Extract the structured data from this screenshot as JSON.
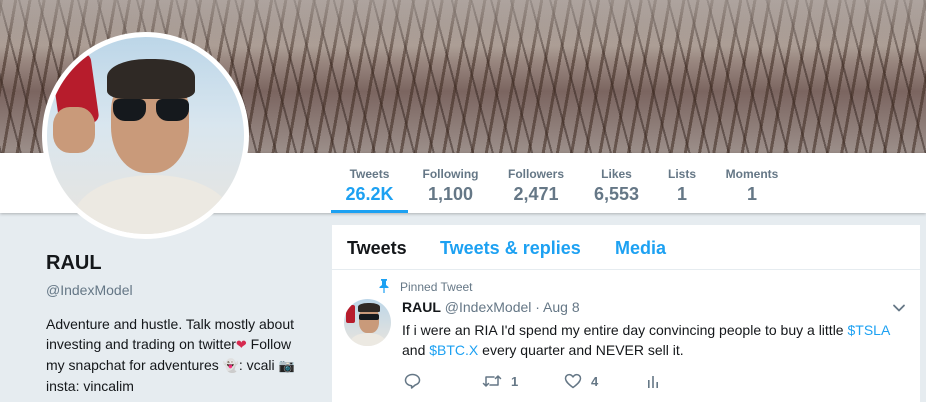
{
  "nav": {
    "stats": [
      {
        "label": "Tweets",
        "value": "26.2K",
        "active": true
      },
      {
        "label": "Following",
        "value": "1,100"
      },
      {
        "label": "Followers",
        "value": "2,471"
      },
      {
        "label": "Likes",
        "value": "6,553"
      },
      {
        "label": "Lists",
        "value": "1"
      },
      {
        "label": "Moments",
        "value": "1"
      }
    ]
  },
  "profile": {
    "name": "RAUL",
    "handle": "@IndexModel",
    "bio": {
      "part1": "Adventure and hustle. Talk mostly about investing and trading on twitter",
      "part2": " Follow my snapchat for adventures ",
      "part3": ": vcali",
      "part4": "insta: vincalim"
    }
  },
  "timeline": {
    "tabs": [
      {
        "label": "Tweets",
        "active": true
      },
      {
        "label": "Tweets & replies"
      },
      {
        "label": "Media"
      }
    ],
    "pinned_label": "Pinned Tweet",
    "tweet": {
      "name": "RAUL",
      "handle": "@IndexModel",
      "separator": " · ",
      "date": "Aug 8",
      "text_part1": "If i were an RIA I'd spend my entire day convincing people to buy a little ",
      "cashtag1": "$TSLA",
      "text_part2": "and ",
      "cashtag2": "$BTC.X",
      "text_part3": " every quarter and NEVER sell it.",
      "retweets": "1",
      "likes": "4"
    }
  },
  "colors": {
    "accent": "#1da1f2",
    "muted": "#657786",
    "background": "#e6ecf0"
  },
  "icons": [
    "pin-icon",
    "reply-icon",
    "retweet-icon",
    "like-icon",
    "analytics-icon",
    "chevron-down-icon",
    "red-heart-emoji",
    "ghost-emoji",
    "camera-emoji"
  ]
}
